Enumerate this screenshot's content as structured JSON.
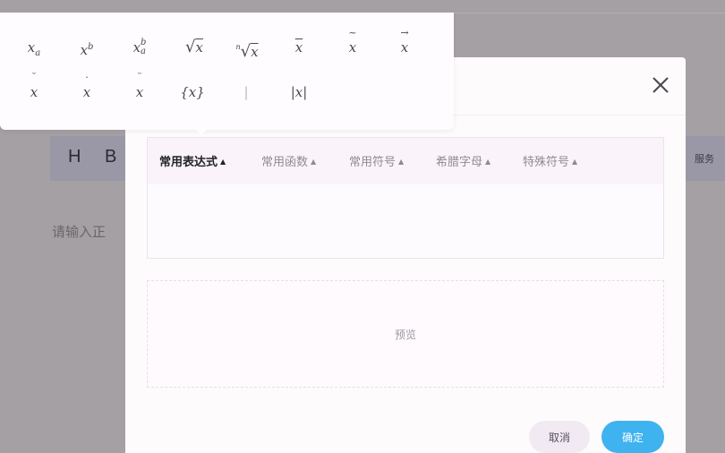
{
  "background": {
    "toolbar": {
      "heading": "H",
      "bold": "B",
      "right_label": "服务"
    },
    "placeholder": "请输入正"
  },
  "popover": {
    "row1": [
      {
        "base": "x",
        "sub": "a",
        "kind": "subscript"
      },
      {
        "base": "x",
        "sup": "b",
        "kind": "superscript"
      },
      {
        "base": "x",
        "sub": "a",
        "sup": "b",
        "kind": "subsup"
      },
      {
        "base": "x",
        "kind": "sqrt"
      },
      {
        "base": "x",
        "index": "n",
        "kind": "nthroot"
      },
      {
        "base": "x",
        "kind": "bar"
      },
      {
        "base": "x",
        "mark": "~",
        "kind": "tilde"
      },
      {
        "base": "x",
        "mark": "→",
        "kind": "vector"
      }
    ],
    "row2": [
      {
        "base": "x",
        "mark": "˘",
        "kind": "breve"
      },
      {
        "base": "x",
        "mark": "·",
        "kind": "dot"
      },
      {
        "base": "x",
        "mark": "¨",
        "kind": "ddot"
      },
      {
        "text": "{x}",
        "kind": "braces"
      },
      {
        "text": "|",
        "kind": "pipe"
      },
      {
        "text": "|x|",
        "kind": "abs"
      }
    ]
  },
  "dialog": {
    "tabs": [
      {
        "label": "常用表达式",
        "active": true
      },
      {
        "label": "常用函数",
        "active": false
      },
      {
        "label": "常用符号",
        "active": false
      },
      {
        "label": "希腊字母",
        "active": false
      },
      {
        "label": "特殊符号",
        "active": false
      }
    ],
    "preview_label": "预览",
    "cancel_label": "取消",
    "ok_label": "确定"
  },
  "icons": {
    "close": "close-icon",
    "tab_caret": "caret-up-icon"
  },
  "colors": {
    "primary": "#3fb2f0",
    "overlay": "#a7a2a6",
    "active_tab_text": "#222226",
    "inactive_tab_text": "#8d8b91"
  }
}
